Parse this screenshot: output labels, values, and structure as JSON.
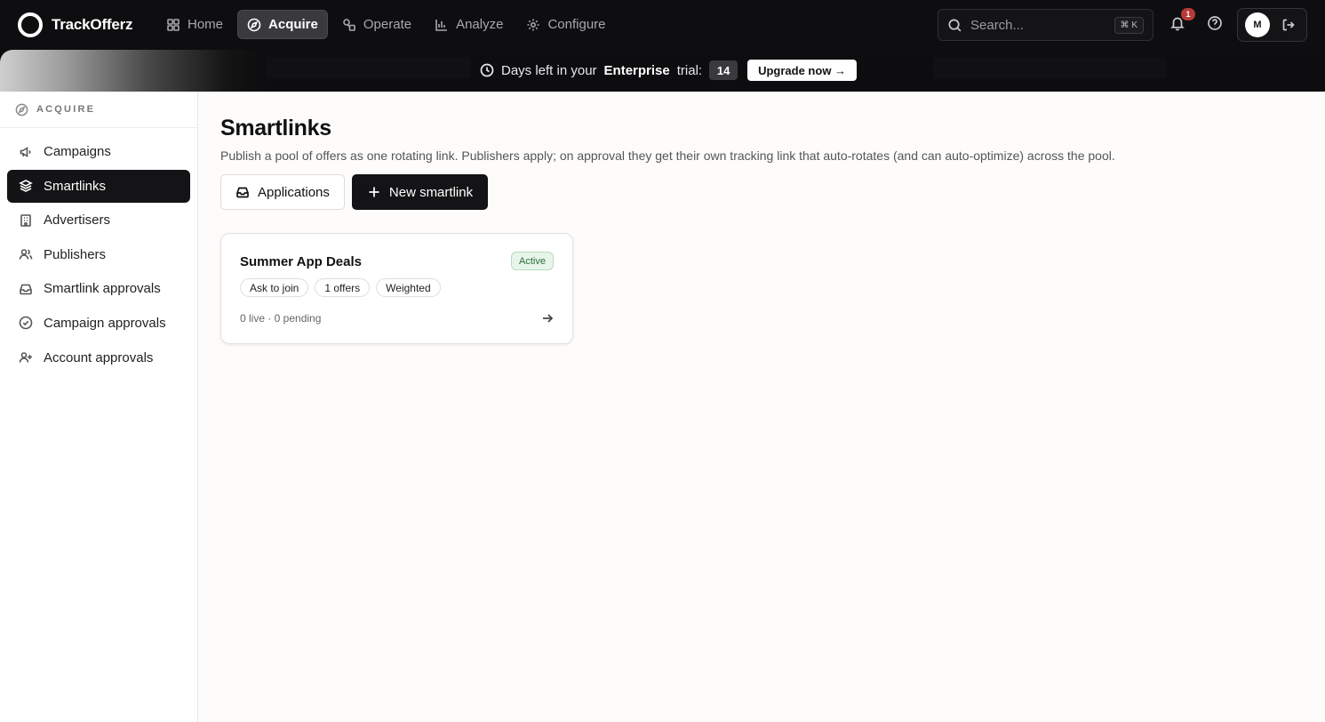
{
  "brand": {
    "name": "TrackOfferz"
  },
  "nav": {
    "items": [
      {
        "label": "Home",
        "icon": "grid-icon"
      },
      {
        "label": "Acquire",
        "icon": "compass-icon",
        "active": true
      },
      {
        "label": "Operate",
        "icon": "shapes-icon"
      },
      {
        "label": "Analyze",
        "icon": "bar-chart-icon"
      },
      {
        "label": "Configure",
        "icon": "gear-icon"
      }
    ]
  },
  "search": {
    "placeholder": "Search...",
    "shortcut": "⌘ K"
  },
  "notifications": {
    "count": "1"
  },
  "user": {
    "initial": "M"
  },
  "banner": {
    "prefix": "Days left in your",
    "plan": "Enterprise",
    "suffix": "trial:",
    "days": "14",
    "cta": "Upgrade now →"
  },
  "sidebar": {
    "section": "ACQUIRE",
    "items": [
      {
        "label": "Campaigns",
        "icon": "megaphone-icon"
      },
      {
        "label": "Smartlinks",
        "icon": "layers-icon",
        "active": true
      },
      {
        "label": "Advertisers",
        "icon": "building-icon"
      },
      {
        "label": "Publishers",
        "icon": "users-icon"
      },
      {
        "label": "Smartlink approvals",
        "icon": "inbox-icon"
      },
      {
        "label": "Campaign approvals",
        "icon": "check-circle-icon"
      },
      {
        "label": "Account approvals",
        "icon": "user-plus-icon"
      }
    ]
  },
  "main": {
    "title": "Smartlinks",
    "subtitle": "Publish a pool of offers as one rotating link. Publishers apply; on approval they get their own tracking link that auto-rotates (and can auto-optimize) across the pool.",
    "actions": {
      "applications": "Applications",
      "new": "New smartlink"
    },
    "cards": [
      {
        "title": "Summer App Deals",
        "status": "Active",
        "tags": [
          "Ask to join",
          "1 offers",
          "Weighted"
        ],
        "footer": "0 live · 0 pending"
      }
    ]
  },
  "colors": {
    "topbar": "#0e0e10",
    "active_nav": "#3a3a3e",
    "sidebar_active": "#141416",
    "status_bg": "#e7f5ea",
    "status_text": "#2f6b3a",
    "badge": "#b83a3a"
  }
}
